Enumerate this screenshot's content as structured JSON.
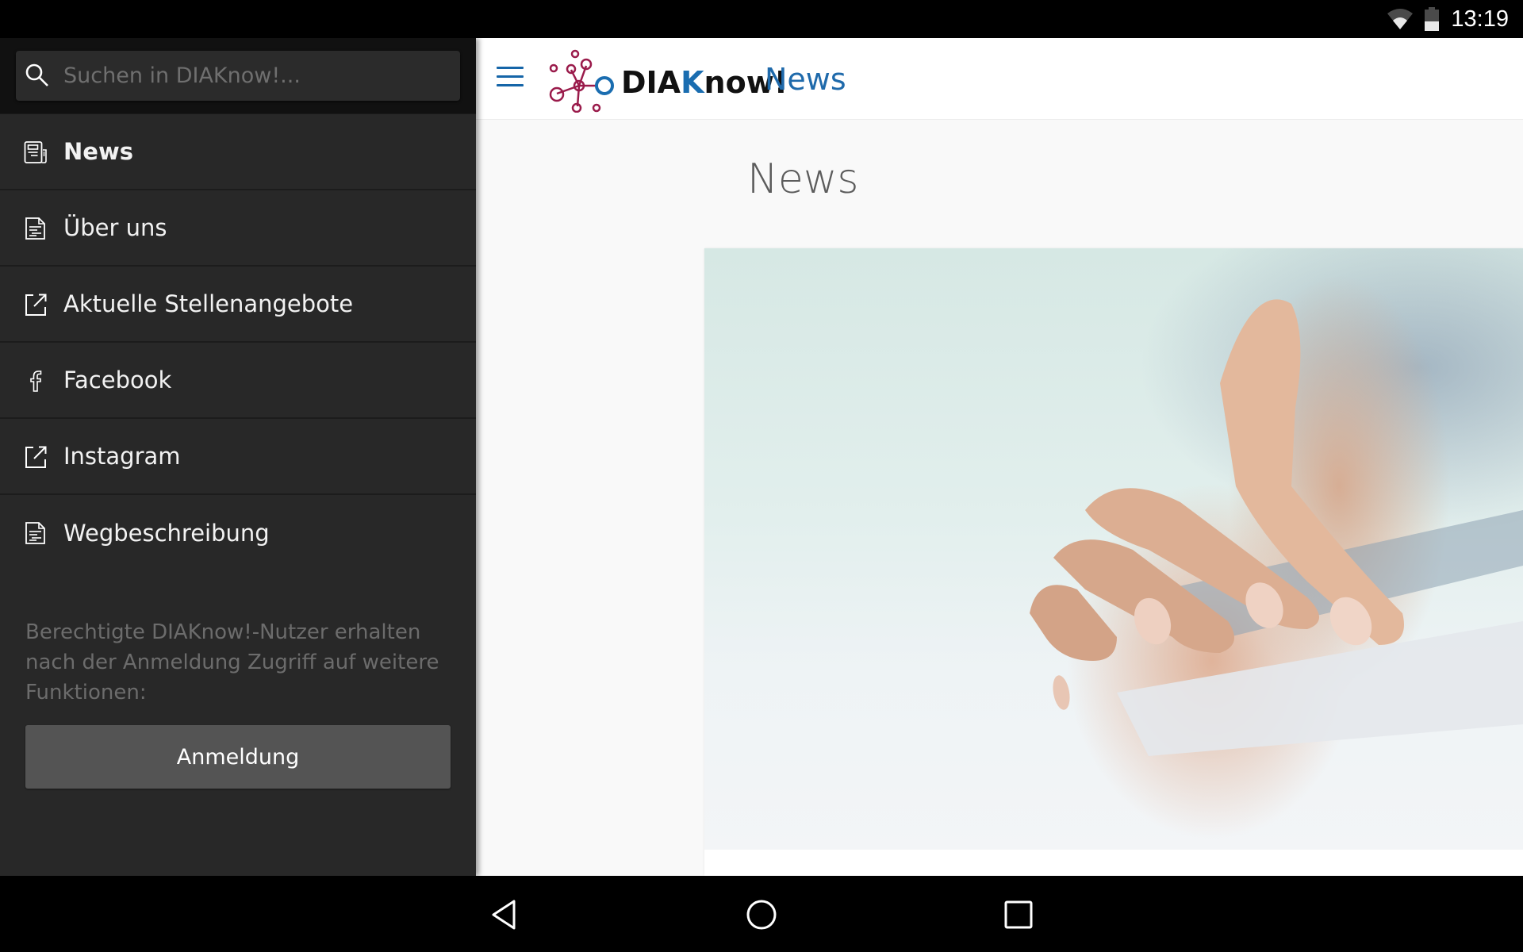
{
  "status_bar": {
    "time": "13:19",
    "icons": [
      "wifi-icon",
      "battery-icon"
    ]
  },
  "drawer": {
    "search": {
      "placeholder": "Suchen in DIAKnow!...",
      "value": "",
      "icon": "search-icon"
    },
    "items": [
      {
        "label": "News",
        "icon": "newspaper-icon",
        "active": true
      },
      {
        "label": "Über uns",
        "icon": "document-icon",
        "active": false
      },
      {
        "label": "Aktuelle Stellenangebote",
        "icon": "external-link-icon",
        "active": false
      },
      {
        "label": "Facebook",
        "icon": "facebook-icon",
        "active": false
      },
      {
        "label": "Instagram",
        "icon": "external-link-icon",
        "active": false
      },
      {
        "label": "Wegbeschreibung",
        "icon": "document-icon",
        "active": false
      }
    ],
    "note": "Berechtigte DIAKnow!-Nutzer erhalten nach der Anmeldung Zugriff auf weitere Funktionen:",
    "login_button": "Anmeldung"
  },
  "app_bar": {
    "brand_prefix": "DIA",
    "brand_k": "K",
    "brand_suffix": "now!",
    "title": "News",
    "colors": {
      "accent": "#1f6aab",
      "logo_secondary": "#9a1b4b"
    }
  },
  "main": {
    "page_title": "News",
    "hero_image_alt": "Hand pointing at tablet"
  },
  "system_nav": {
    "buttons": [
      "back",
      "home",
      "recents"
    ]
  }
}
